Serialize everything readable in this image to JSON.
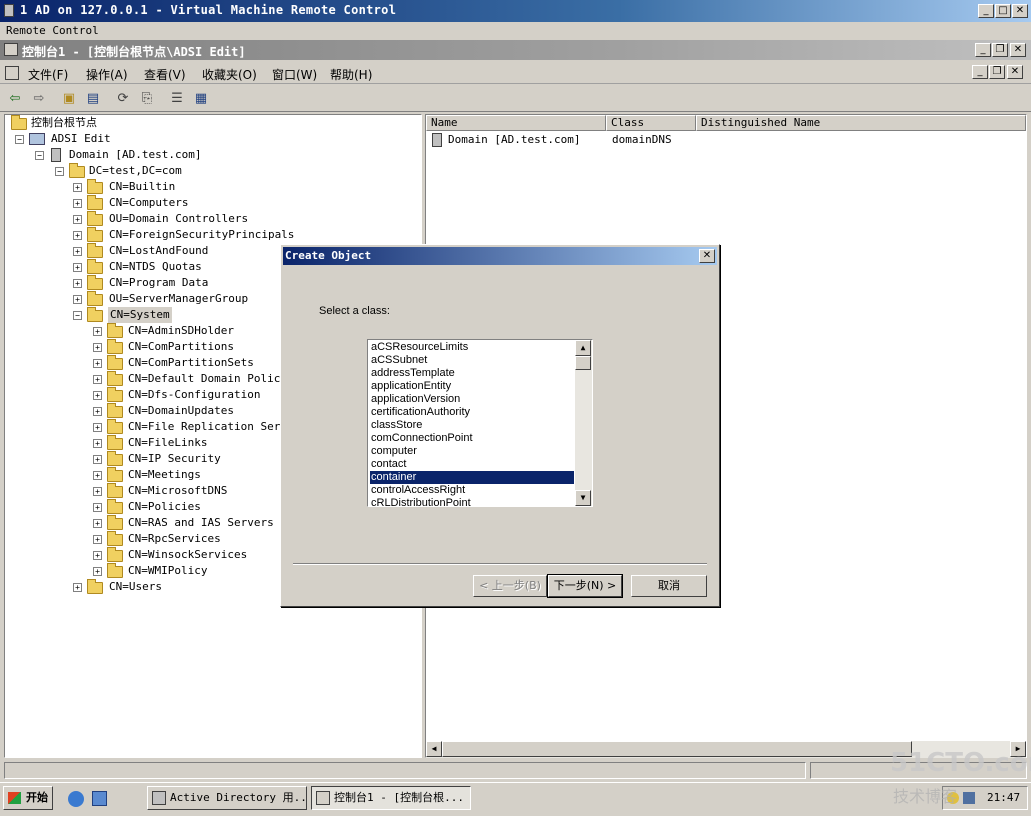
{
  "vm_window": {
    "title": "1 AD on 127.0.0.1 - Virtual Machine Remote Control",
    "menu": "Remote Control"
  },
  "mmc": {
    "title": "控制台1 - [控制台根节点\\ADSI Edit]",
    "menu": [
      "文件(F)",
      "操作(A)",
      "查看(V)",
      "收藏夹(O)",
      "窗口(W)",
      "帮助(H)"
    ]
  },
  "tree": {
    "root": "控制台根节点",
    "adsi": "ADSI Edit",
    "domain": "Domain [AD.test.com]",
    "dc": "DC=test,DC=com",
    "children": [
      "CN=Builtin",
      "CN=Computers",
      "OU=Domain Controllers",
      "CN=ForeignSecurityPrincipals",
      "CN=LostAndFound",
      "CN=NTDS Quotas",
      "CN=Program Data",
      "OU=ServerManagerGroup"
    ],
    "system": "CN=System",
    "system_children": [
      "CN=AdminSDHolder",
      "CN=ComPartitions",
      "CN=ComPartitionSets",
      "CN=Default Domain Policy",
      "CN=Dfs-Configuration",
      "CN=DomainUpdates",
      "CN=File Replication Servic",
      "CN=FileLinks",
      "CN=IP Security",
      "CN=Meetings",
      "CN=MicrosoftDNS",
      "CN=Policies",
      "CN=RAS and IAS Servers Acc",
      "CN=RpcServices",
      "CN=WinsockServices",
      "CN=WMIPolicy"
    ],
    "users": "CN=Users"
  },
  "list": {
    "columns": [
      "Name",
      "Class",
      "Distinguished Name"
    ],
    "rows": [
      {
        "name": "Domain [AD.test.com]",
        "class": "domainDNS",
        "dn": ""
      }
    ]
  },
  "dialog": {
    "title": "Create Object",
    "prompt": "Select a class:",
    "classes": [
      "aCSResourceLimits",
      "aCSSubnet",
      "addressTemplate",
      "applicationEntity",
      "applicationVersion",
      "certificationAuthority",
      "classStore",
      "comConnectionPoint",
      "computer",
      "contact",
      "container",
      "controlAccessRight",
      "cRLDistributionPoint"
    ],
    "selected": "container",
    "back": "< 上一步(B)",
    "next": "下一步(N) >",
    "cancel": "取消"
  },
  "taskbar": {
    "start": "开始",
    "tasks": [
      "Active Directory 用...",
      "控制台1 - [控制台根..."
    ],
    "clock": "21:47"
  },
  "watermark": {
    "line1": "51CTO.com",
    "line2": "技术博客"
  },
  "icons": [
    "back-arrow-icon",
    "forward-arrow-icon",
    "up-folder-icon",
    "show-tree-icon",
    "refresh-icon",
    "export-icon",
    "properties-icon",
    "help-icon"
  ]
}
